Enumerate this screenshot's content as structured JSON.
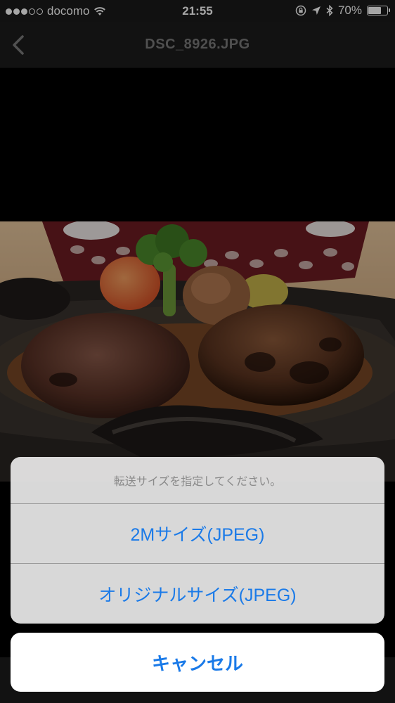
{
  "status_bar": {
    "carrier": "docomo",
    "time": "21:55",
    "battery_percent": "70%",
    "battery_level": 0.7,
    "signal_bars_filled": 3,
    "signal_bars_total": 5
  },
  "nav": {
    "back_icon": "chevron-left-icon",
    "title": "DSC_8926.JPG"
  },
  "action_sheet": {
    "message": "転送サイズを指定してください。",
    "options": [
      {
        "label": "2Mサイズ(JPEG)"
      },
      {
        "label": "オリジナルサイズ(JPEG)"
      }
    ],
    "cancel_label": "キャンセル"
  },
  "colors": {
    "accent": "#1a7ae8",
    "nav_background": "#1c1c1c",
    "sheet_background": "#e8e8e8"
  }
}
